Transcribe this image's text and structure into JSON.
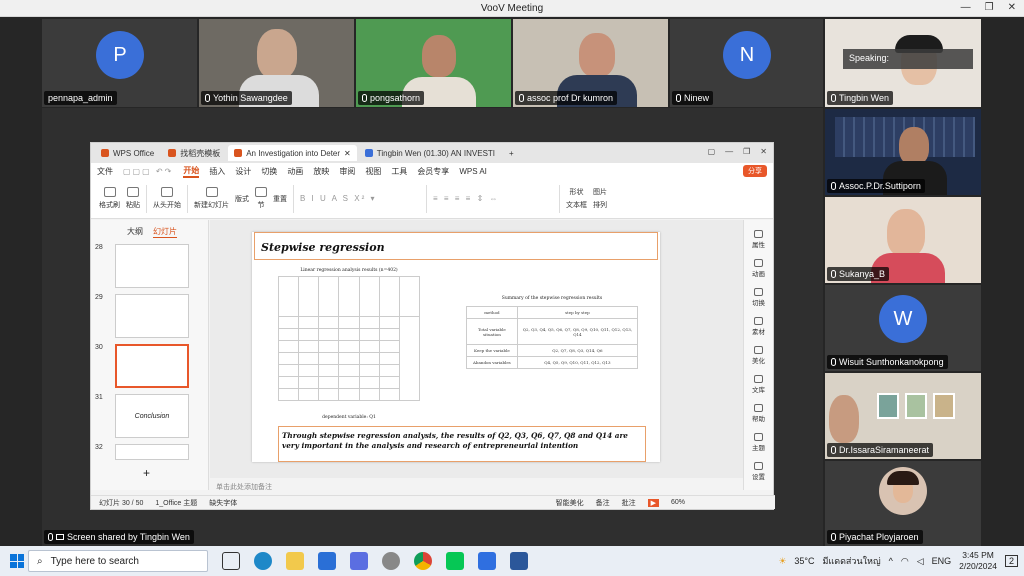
{
  "window": {
    "title": "VooV Meeting"
  },
  "participants_top": [
    {
      "name": "pennapa_admin",
      "initial": "P",
      "has_video": false,
      "muted_icon": false,
      "avatar_color": "#3a6fd8"
    },
    {
      "name": "Yothin Sawangdee",
      "has_video": true,
      "muted_icon": true
    },
    {
      "name": "pongsathorn",
      "has_video": true,
      "muted_icon": true
    },
    {
      "name": "assoc prof Dr kumron",
      "has_video": true,
      "muted_icon": true
    },
    {
      "name": "Ninew",
      "initial": "N",
      "has_video": false,
      "muted_icon": true,
      "avatar_color": "#3a6fd8"
    }
  ],
  "participants_side": [
    {
      "name": "Tingbin Wen",
      "has_video": true,
      "speaking_label": "Speaking:"
    },
    {
      "name": "Assoc.P.Dr.Suttiporn",
      "has_video": true
    },
    {
      "name": "Sukanya_B",
      "has_video": true
    },
    {
      "name": "Wisuit Sunthonkanokpong",
      "initial": "W",
      "has_video": false,
      "avatar_color": "#3a6fd8"
    },
    {
      "name": "Dr.IssaraSiramaneerat",
      "has_video": true
    },
    {
      "name": "Piyachat Ployjaroen",
      "has_video": true
    }
  ],
  "share": {
    "label": "Screen shared by Tingbin Wen"
  },
  "wps": {
    "tabs": [
      {
        "label": "WPS Office",
        "color": "#d9541e"
      },
      {
        "label": "找稻壳模板",
        "color": "#d9541e"
      },
      {
        "label": "An Investigation into Deter",
        "color": "#d9541e",
        "active": true
      },
      {
        "label": "Tingbin Wen (01.30) AN INVESTI",
        "color": "#3b6fd8"
      }
    ],
    "menu": [
      "文件",
      "开始",
      "插入",
      "设计",
      "切换",
      "动画",
      "放映",
      "审阅",
      "视图",
      "工具",
      "会员专享",
      "WPS AI"
    ],
    "active_menu": "开始",
    "share_button": "分享",
    "ribbon": [
      "格式刷",
      "粘贴",
      "从头开始",
      "新建幻灯片",
      "版式",
      "节",
      "重置",
      "形状",
      "图片",
      "文本框",
      "排列"
    ],
    "left_tabs": {
      "outline": "大纲",
      "slides": "幻灯片"
    },
    "thumb_numbers": [
      "28",
      "29",
      "30",
      "31",
      "32"
    ],
    "thumb_31_text": "Conclusion",
    "slide": {
      "title": "Stepwise regression",
      "table1_title": "Linear regression analysis results (n=402)",
      "table2_title": "Summary of the stepwise regression results",
      "table2_rows": [
        [
          "method",
          "step by step"
        ],
        [
          "Total variable situation",
          "Q2, Q3, Q4, Q5, Q6, Q7, Q8, Q9, Q10, Q11, Q12, Q13, Q14"
        ],
        [
          "Keep the variable",
          "Q2, Q7, Q8, Q3, Q14, Q6"
        ],
        [
          "Abandon variables",
          "Q4, Q5, Q9, Q10, Q11, Q12, Q13"
        ]
      ],
      "dependent_note": "dependent variable: Q1",
      "conclusion": "Through stepwise regression analysis, the results of Q2, Q3, Q6, Q7, Q8 and Q14 are very important in the analysis and research of entrepreneurial intention"
    },
    "notes_placeholder": "单击此处添加备注",
    "right_panel": [
      "属性",
      "动画",
      "切换",
      "素材",
      "美化",
      "文库",
      "帮助",
      "主题",
      "设置"
    ],
    "status": {
      "slide_count": "幻灯片 30 / 50",
      "theme": "1_Office 主题",
      "font_missing": "缺失字体",
      "smart": "智能美化",
      "notes": "备注",
      "comments": "批注",
      "zoom": "60%"
    }
  },
  "taskbar": {
    "search_placeholder": "Type here to search",
    "weather": "35°C",
    "weather_text": "มีแดดส่วนใหญ่",
    "lang": "ENG",
    "time": "3:45 PM",
    "date": "2/20/2024",
    "notif_count": "2"
  }
}
